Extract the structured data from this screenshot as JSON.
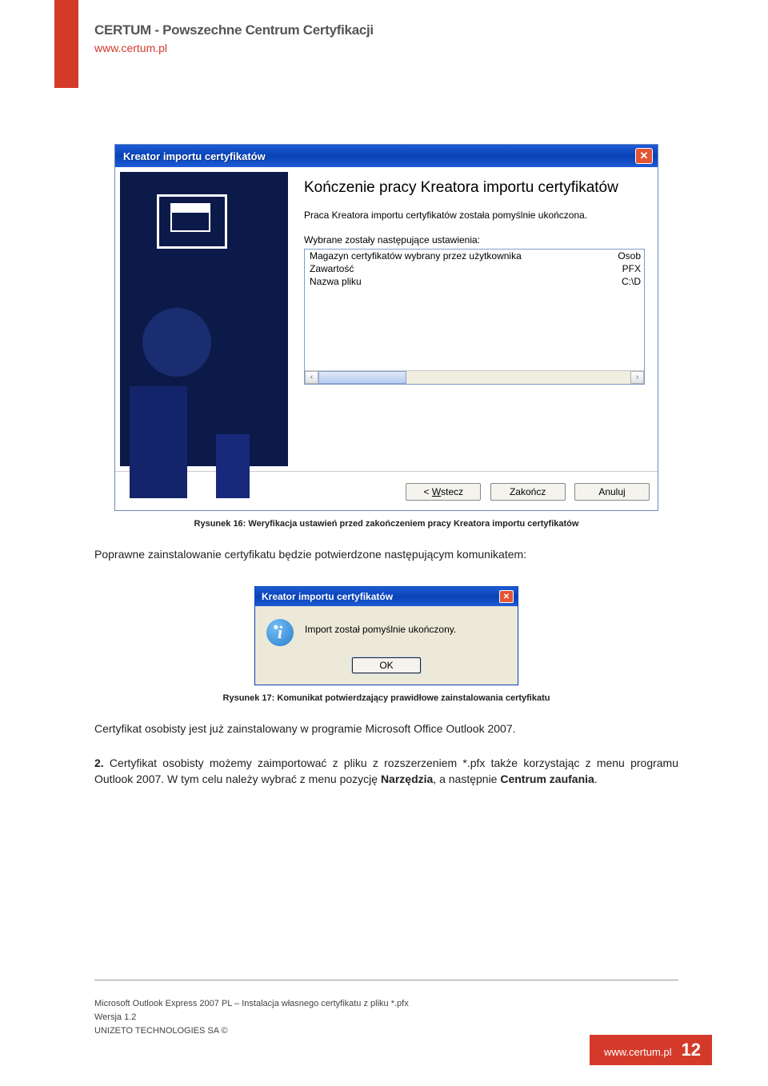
{
  "header": {
    "title": "CERTUM - Powszechne Centrum Certyfikacji",
    "url": "www.certum.pl"
  },
  "wizard": {
    "title": "Kreator importu certyfikatów",
    "heading": "Kończenie pracy Kreatora importu certyfikatów",
    "desc": "Praca Kreatora importu certyfikatów została pomyślnie ukończona.",
    "settings_label": "Wybrane zostały następujące ustawienia:",
    "rows": [
      {
        "k": "Magazyn certyfikatów wybrany przez użytkownika",
        "v": "Osob"
      },
      {
        "k": "Zawartość",
        "v": "PFX"
      },
      {
        "k": "Nazwa pliku",
        "v": "C:\\D"
      }
    ],
    "buttons": {
      "back_prefix": "< ",
      "back_u": "W",
      "back_rest": "stecz",
      "finish": "Zakończ",
      "cancel": "Anuluj"
    }
  },
  "caption1": "Rysunek 16: Weryfikacja ustawień przed zakończeniem pracy Kreatora importu certyfikatów",
  "para1": "Poprawne zainstalowanie certyfikatu będzie potwierdzone następującym komunikatem:",
  "dialog": {
    "title": "Kreator importu certyfikatów",
    "message": "Import został pomyślnie ukończony.",
    "ok": "OK"
  },
  "caption2": "Rysunek 17: Komunikat potwierdzający prawidłowe zainstalowania certyfikatu",
  "para2": "Certyfikat osobisty jest już zainstalowany w programie Microsoft Office Outlook 2007.",
  "para3_prefix": "2.",
  "para3_a": " Certyfikat osobisty możemy zaimportować z pliku z rozszerzeniem *.pfx także korzystając z menu programu Outlook 2007. W tym celu należy wybrać z menu pozycję ",
  "para3_b1": "Narzędzia",
  "para3_mid": ", a następnie ",
  "para3_b2": "Centrum zaufania",
  "para3_end": ".",
  "footer": {
    "line1": "Microsoft Outlook Express 2007 PL – Instalacja własnego certyfikatu  z pliku *.pfx",
    "line2": "Wersja 1.2",
    "line3": "UNIZETO TECHNOLOGIES SA ©"
  },
  "pagenum": {
    "url": "www.certum.pl",
    "num": "12"
  }
}
